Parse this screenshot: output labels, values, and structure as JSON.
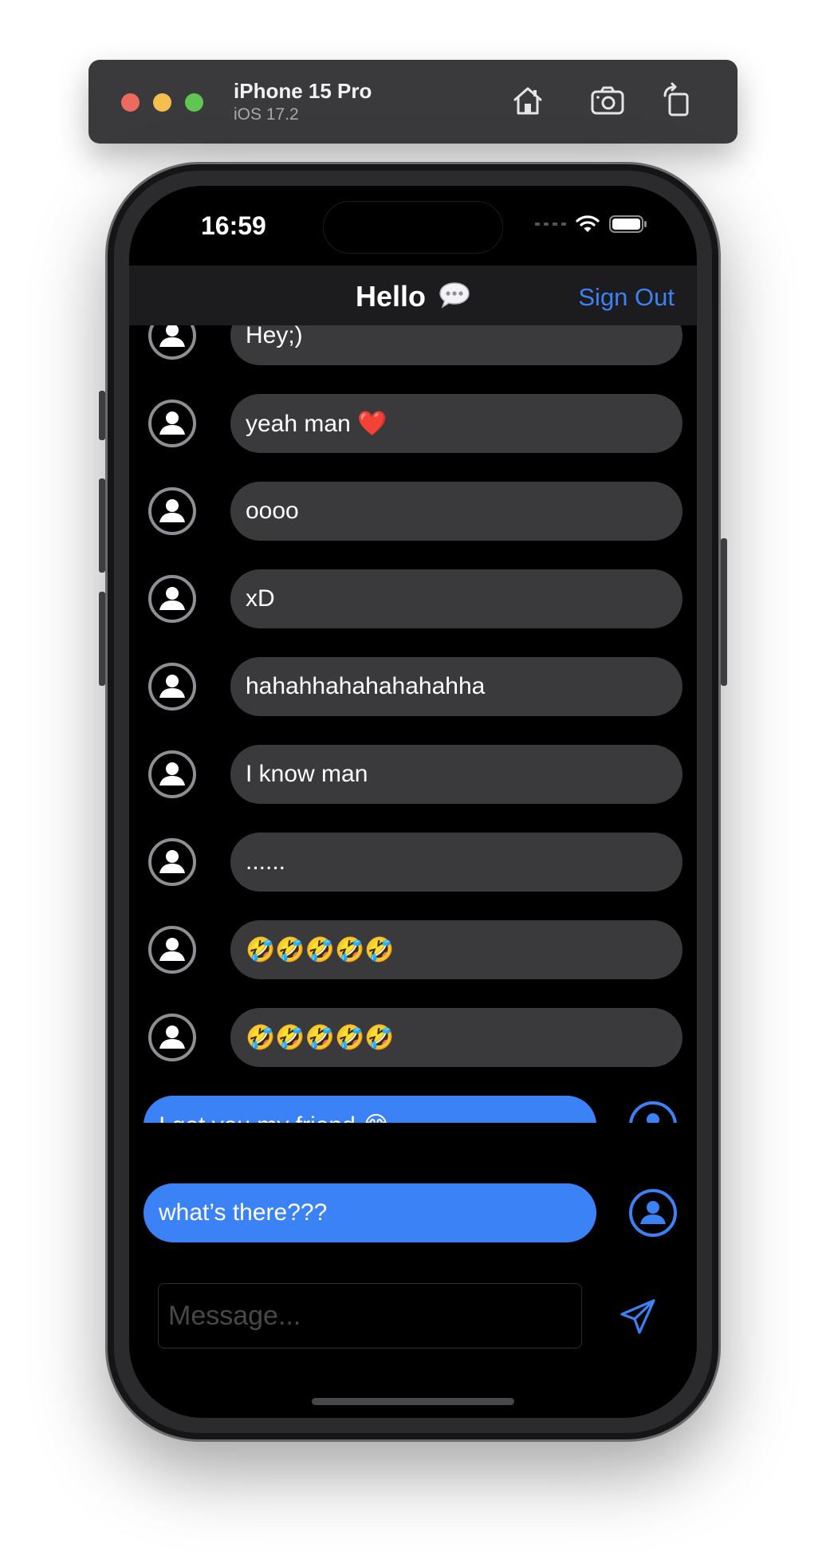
{
  "simulator": {
    "device_name": "iPhone 15 Pro",
    "os_version": "iOS 17.2",
    "buttons": [
      "home-icon",
      "screenshot-icon",
      "rotate-icon"
    ]
  },
  "status_bar": {
    "time": "16:59",
    "icons": [
      "cellular-dots-icon",
      "wifi-icon",
      "battery-icon"
    ]
  },
  "nav": {
    "title": "Hello",
    "title_icon": "speech-bubble-icon",
    "sign_out_label": "Sign Out"
  },
  "messages": [
    {
      "text": "Hey;)",
      "direction": "incoming"
    },
    {
      "text": "yeah man ❤️",
      "direction": "incoming"
    },
    {
      "text": "oooo",
      "direction": "incoming"
    },
    {
      "text": "xD",
      "direction": "incoming"
    },
    {
      "text": "hahahhahahahahahha",
      "direction": "incoming"
    },
    {
      "text": "I know man",
      "direction": "incoming"
    },
    {
      "text": "......",
      "direction": "incoming"
    },
    {
      "text": "🤣🤣🤣🤣🤣",
      "direction": "incoming"
    },
    {
      "text": "🤣🤣🤣🤣🤣",
      "direction": "incoming"
    },
    {
      "text": "I get you my friend 😂",
      "direction": "outgoing"
    },
    {
      "text": "what’s there???",
      "direction": "outgoing"
    }
  ],
  "composer": {
    "placeholder": "Message...",
    "value": "",
    "send_icon": "paper-plane-icon"
  },
  "colors": {
    "accent": "#3b82f6",
    "incoming_bubble": "#3a3a3c",
    "background": "#000000"
  }
}
